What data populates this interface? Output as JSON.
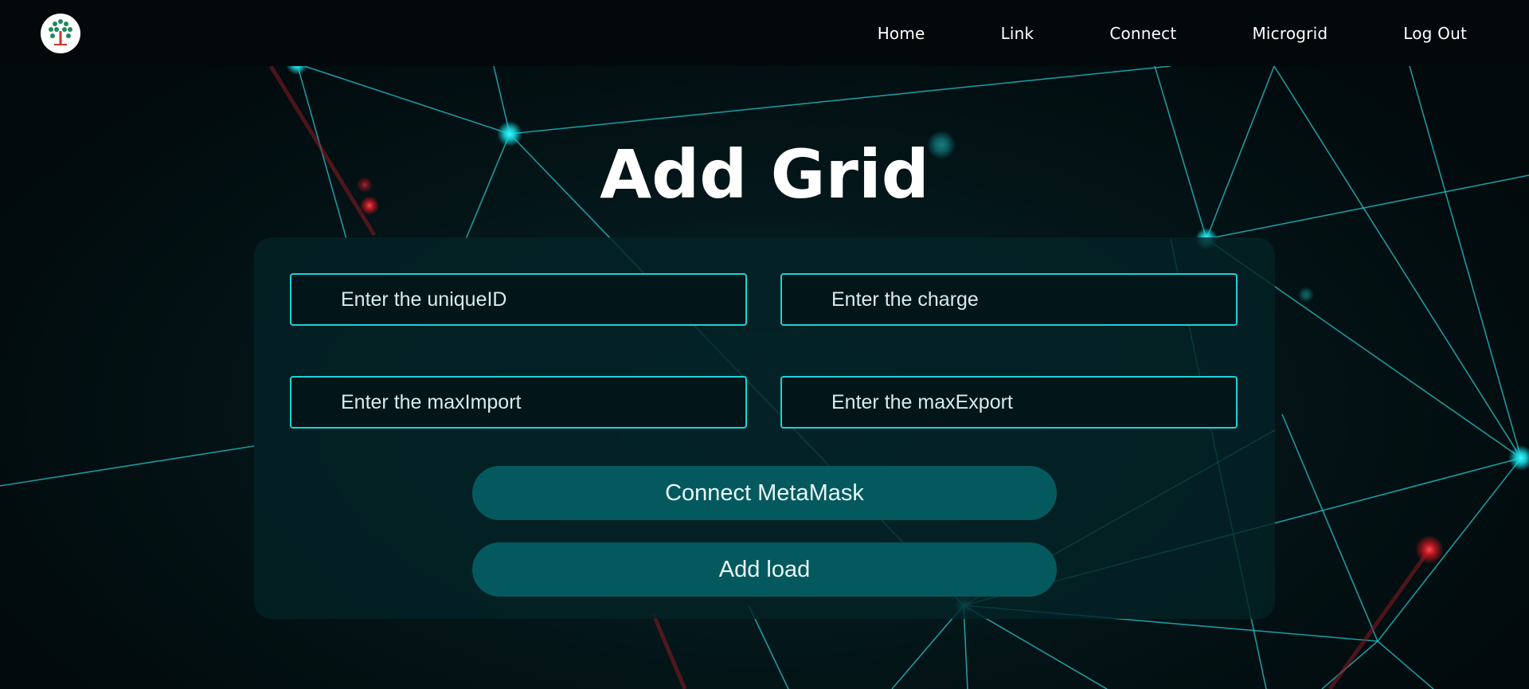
{
  "nav": {
    "logo_icon": "tree-logo-icon",
    "links": [
      {
        "label": "Home"
      },
      {
        "label": "Link"
      },
      {
        "label": "Connect"
      },
      {
        "label": "Microgrid"
      },
      {
        "label": "Log Out"
      }
    ]
  },
  "main": {
    "title": "Add Grid"
  },
  "form": {
    "unique_id_placeholder": "Enter the uniqueID",
    "charge_placeholder": "Enter the charge",
    "max_import_placeholder": "Enter the maxImport",
    "max_export_placeholder": "Enter the maxExport",
    "connect_label": "Connect MetaMask",
    "add_label": "Add load"
  },
  "colors": {
    "background": "#02090b",
    "navbar": "#03080a",
    "accent": "#1ad3d8",
    "button": "#04595f",
    "node_cyan": "#1ff0f5",
    "node_red": "#e0242f"
  }
}
